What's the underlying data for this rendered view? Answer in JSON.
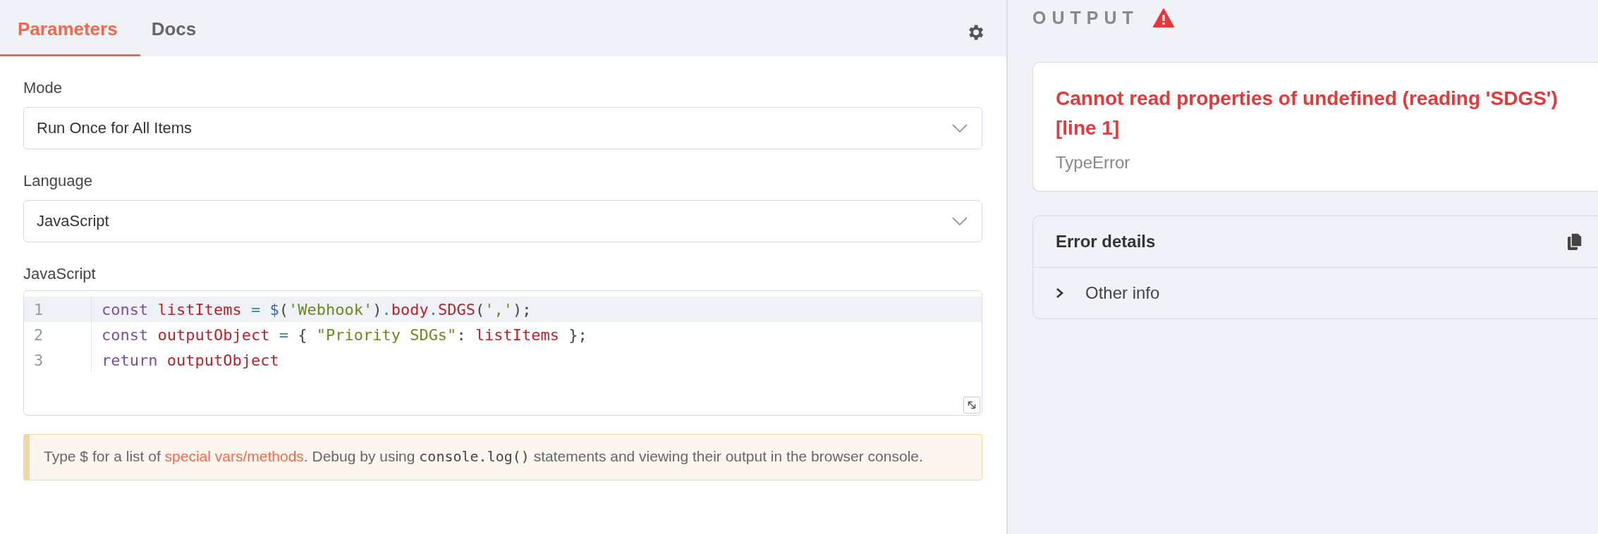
{
  "tabs": [
    {
      "label": "Parameters",
      "selected": true
    },
    {
      "label": "Docs",
      "selected": false
    }
  ],
  "fields": [
    {
      "label": "Mode",
      "value": "Run Once for All Items"
    },
    {
      "label": "Language",
      "value": "JavaScript"
    }
  ],
  "editor": {
    "label": "JavaScript",
    "lines": [
      {
        "number": "1",
        "active": true,
        "tokens": [
          {
            "kind": "keyword",
            "text": "const "
          },
          {
            "kind": "variable",
            "text": "listItems"
          },
          {
            "kind": "operator",
            "text": " = "
          },
          {
            "kind": "func",
            "text": "$"
          },
          {
            "kind": "punct",
            "text": "("
          },
          {
            "kind": "string",
            "text": "'Webhook'"
          },
          {
            "kind": "punct",
            "text": ")"
          },
          {
            "kind": "operator",
            "text": "."
          },
          {
            "kind": "variable",
            "text": "body"
          },
          {
            "kind": "operator",
            "text": "."
          },
          {
            "kind": "variable",
            "text": "SDGS"
          },
          {
            "kind": "punct",
            "text": "("
          },
          {
            "kind": "string",
            "text": "','"
          },
          {
            "kind": "punct",
            "text": ");"
          }
        ]
      },
      {
        "number": "2",
        "active": false,
        "tokens": [
          {
            "kind": "keyword",
            "text": "const "
          },
          {
            "kind": "variable",
            "text": "outputObject"
          },
          {
            "kind": "operator",
            "text": " = "
          },
          {
            "kind": "punct",
            "text": "{ "
          },
          {
            "kind": "string",
            "text": "\"Priority SDGs\""
          },
          {
            "kind": "punct",
            "text": ": "
          },
          {
            "kind": "variable",
            "text": "listItems"
          },
          {
            "kind": "punct",
            "text": " };"
          }
        ]
      },
      {
        "number": "3",
        "active": false,
        "tokens": [
          {
            "kind": "keyword",
            "text": "return "
          },
          {
            "kind": "variable",
            "text": "outputObject"
          }
        ]
      }
    ]
  },
  "hint": [
    {
      "kind": "text",
      "text": "Type $ for a list of "
    },
    {
      "kind": "link",
      "text": "special vars/methods"
    },
    {
      "kind": "text",
      "text": ". Debug by using "
    },
    {
      "kind": "code",
      "text": "console.log()"
    },
    {
      "kind": "text",
      "text": " statements and viewing their output in the browser console."
    }
  ],
  "output": {
    "title": "OUTPUT",
    "error": {
      "message": "Cannot read properties of undefined (reading 'SDGS') [line 1]",
      "type": "TypeError"
    },
    "details": {
      "title": "Error details",
      "items": [
        {
          "label": "Other info",
          "expanded": false
        }
      ]
    }
  }
}
